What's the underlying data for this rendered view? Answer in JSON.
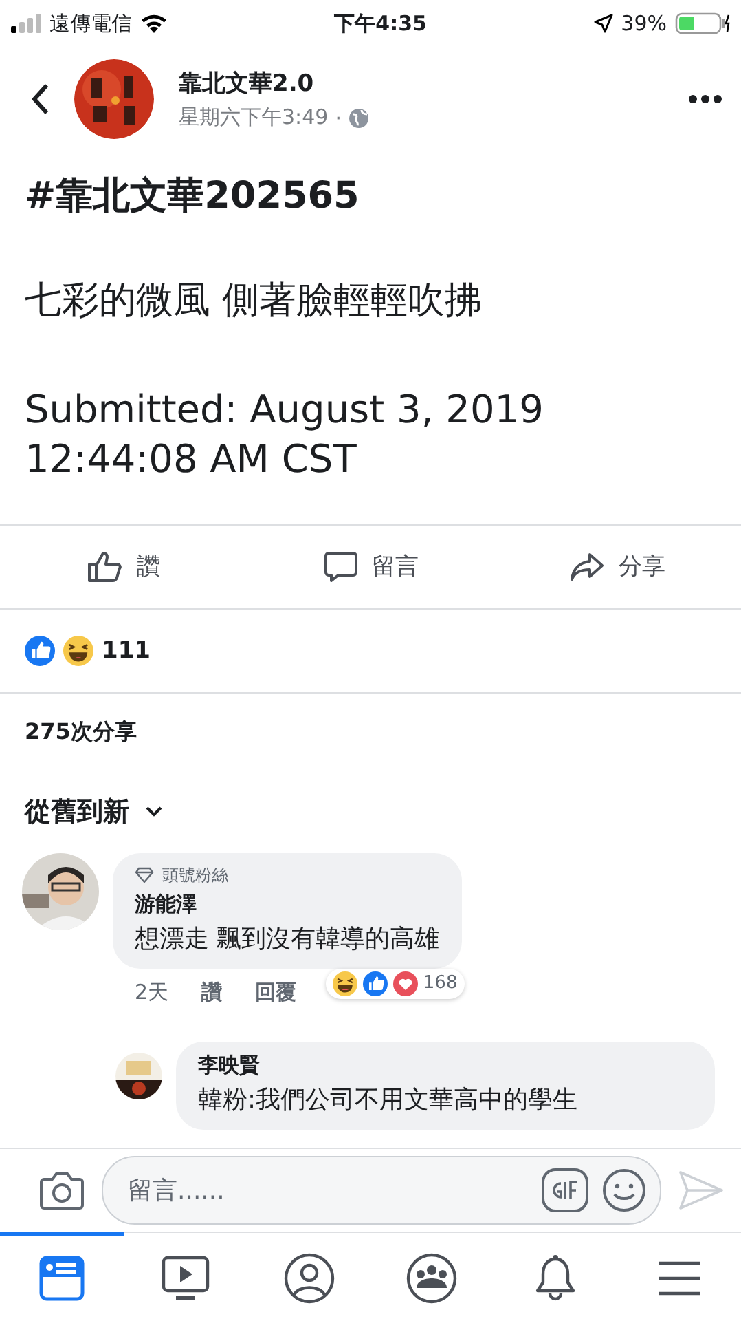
{
  "status_bar": {
    "carrier": "遠傳電信",
    "time": "下午4:35",
    "battery": "39%"
  },
  "post": {
    "page_name": "靠北文華2.0",
    "timestamp": "星期六下午3:49",
    "separator": "·",
    "hashtag": "#靠北文華202565",
    "body": "七彩的微風 側著臉輕輕吹拂",
    "submitted": "Submitted:  August 3, 2019\n12:44:08 AM CST"
  },
  "actions": [
    {
      "kind": "like",
      "label": "讚"
    },
    {
      "kind": "comment",
      "label": "留言"
    },
    {
      "kind": "share",
      "label": "分享"
    }
  ],
  "reactions": {
    "count": "111"
  },
  "shares": "275次分享",
  "sort": {
    "label": "從舊到新"
  },
  "comments": [
    {
      "badge": "頭號粉絲",
      "author": "游能澤",
      "text": "想漂走 飄到沒有韓導的高雄",
      "age": "2天",
      "like": "讚",
      "reply": "回覆",
      "reaction_count": "168"
    },
    {
      "author": "李映賢",
      "text": "韓粉:我們公司不用文華高中的學生"
    }
  ],
  "composer": {
    "placeholder": "留言......"
  },
  "tabs": [
    {
      "kind": "feed",
      "selected": true
    },
    {
      "kind": "video",
      "selected": false
    },
    {
      "kind": "profile",
      "selected": false
    },
    {
      "kind": "groups",
      "selected": false
    },
    {
      "kind": "notifications",
      "selected": false
    },
    {
      "kind": "menu",
      "selected": false
    }
  ]
}
